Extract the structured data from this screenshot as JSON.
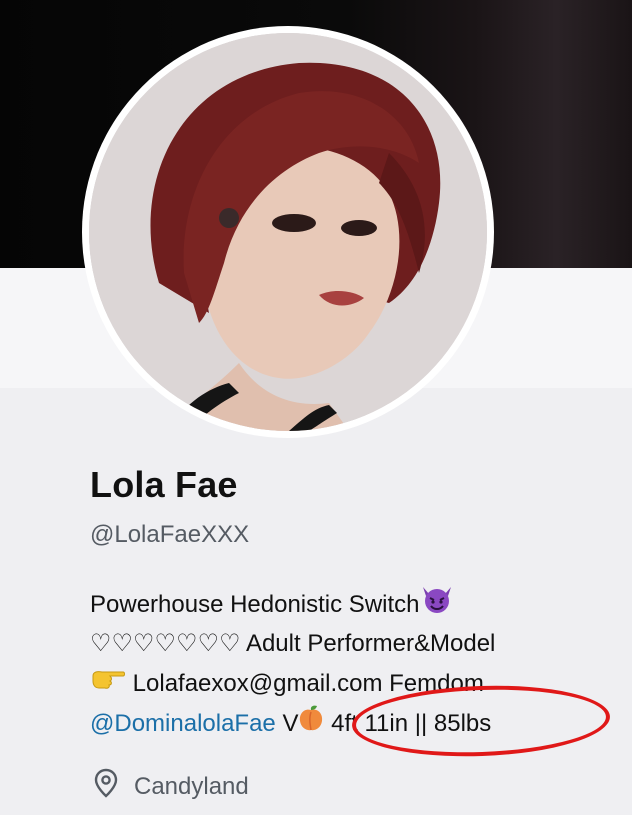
{
  "profile": {
    "name": "Lola Fae",
    "handle": "@LolaFaeXXX",
    "bio": {
      "line1_text": "Powerhouse Hedonistic Switch",
      "line1_emoji": "smiling-devil-emoji",
      "line2_hearts": "♡♡♡♡♡♡♡",
      "line2_text": " Adult Performer&Model",
      "line3_emoji": "pointing-hand-emoji",
      "line3_text": " Lolafaexox@gmail.com Femdom",
      "line4_mention": "@DominalolaFae",
      "line4_v": " V",
      "line4_emoji": "peach-emoji",
      "line4_stats": " 4ft 11in || 85lbs"
    },
    "location": "Candyland"
  },
  "colors": {
    "mention": "#1b6fa8",
    "annotation": "#e01818",
    "secondary_text": "#555b63"
  }
}
